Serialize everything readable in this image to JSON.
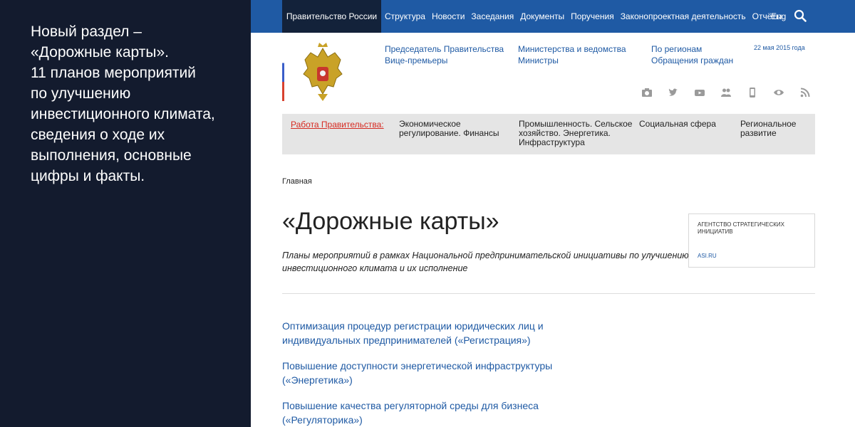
{
  "slide": {
    "lines": [
      "Новый раздел –",
      "«Дорожные карты».",
      "11 планов мероприятий",
      "по улучшению",
      "инвестиционного климата,",
      "сведения о ходе их",
      "выполнения, основные",
      "цифры и факты."
    ]
  },
  "nav": {
    "home": "Правительство России",
    "items": [
      "Структура",
      "Новости",
      "Заседания",
      "Документы",
      "Поручения",
      "Законопроектная деятельность",
      "Отчёты"
    ],
    "lang": "Eng",
    "search_icon": "search-icon"
  },
  "header": {
    "col1": [
      "Председатель Правительства",
      "Вице-премьеры"
    ],
    "col2": [
      "Министерства и ведомства",
      "Министры"
    ],
    "col3": [
      "По регионам",
      "Обращения граждан"
    ],
    "date": "22 мая 2015 года",
    "social_icons": [
      "camera-icon",
      "twitter-icon",
      "youtube-icon",
      "people-icon",
      "mobile-icon",
      "eye-icon",
      "rss-icon"
    ],
    "emblem_icon": "coat-of-arms-icon"
  },
  "work": {
    "title": "Работа Правительства:",
    "categories": [
      [
        "Экономическое",
        "регулирование. Финансы"
      ],
      [
        "Промышленность. Сельское",
        "хозяйство. Энергетика.",
        "Инфраструктура"
      ],
      [
        "Социальная сфера"
      ],
      [
        "Региональное",
        "развитие"
      ]
    ]
  },
  "breadcrumb": "Главная",
  "page_title": "«Дорожные карты»",
  "subtitle": [
    "Планы мероприятий в рамках Национальной предпринимательской инициативы по улучшению",
    "инвестиционного климата и их исполнение"
  ],
  "asi": {
    "title": [
      "АГЕНТСТВО СТРАТЕГИЧЕСКИХ",
      "ИНИЦИАТИВ"
    ],
    "link": "ASI.RU"
  },
  "roadmaps": [
    [
      "Оптимизация процедур регистрации юридических лиц и",
      "индивидуальных предпринимателей («Регистрация»)"
    ],
    [
      "Повышение доступности энергетической инфраструктуры",
      "(«Энергетика»)"
    ],
    [
      "Повышение качества регуляторной среды для бизнеса",
      "(«Регуляторика»)"
    ]
  ],
  "colors": {
    "left_bg": "#131b2e",
    "nav_bg": "#1f5aa4",
    "nav_active": "#13223a",
    "link": "#1f5aa4",
    "work_title": "#d62b22"
  }
}
